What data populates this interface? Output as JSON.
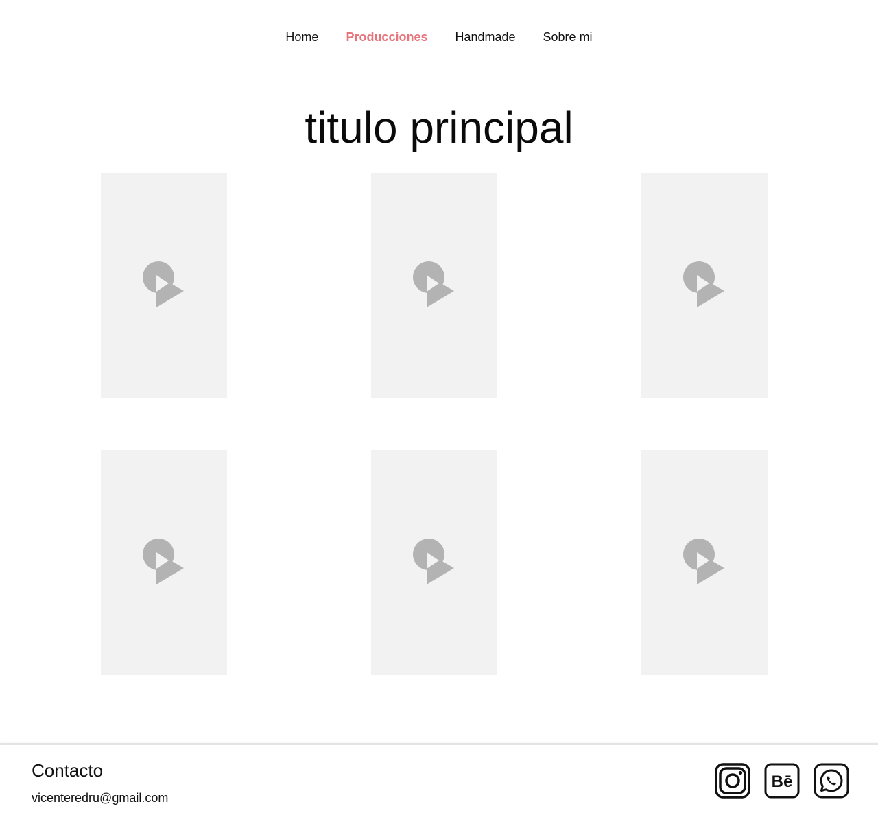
{
  "nav": {
    "items": [
      {
        "label": "Home",
        "active": false
      },
      {
        "label": "Producciones",
        "active": true
      },
      {
        "label": "Handmade",
        "active": false
      },
      {
        "label": "Sobre mi",
        "active": false
      }
    ]
  },
  "main": {
    "title": "titulo principal",
    "video_count": 6
  },
  "footer": {
    "heading": "Contacto",
    "email": "vicenteredru@gmail.com",
    "social": [
      {
        "icon": "instagram-icon"
      },
      {
        "icon": "behance-icon",
        "glyph": "Bē"
      },
      {
        "icon": "whatsapp-icon"
      }
    ]
  },
  "colors": {
    "accent": "#e8737a",
    "placeholder_bg": "#f2f2f2",
    "placeholder_icon": "#b3b3b3",
    "text": "#111111"
  }
}
